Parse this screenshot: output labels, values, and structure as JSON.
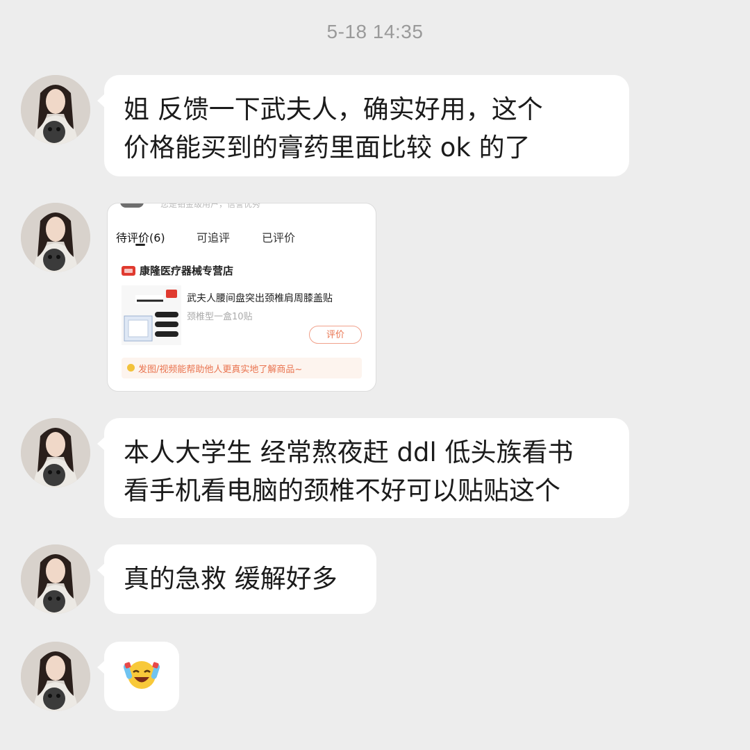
{
  "timestamp": "5-18 14:35",
  "messages": [
    {
      "lines": [
        "姐 反馈一下武夫人，确实好用，这个",
        "价格能买到的膏药里面比较 ok 的了"
      ]
    },
    {
      "lines": [
        "本人大学生 经常熬夜赶 ddl 低头族看书",
        "看手机看电脑的颈椎不好可以贴贴这个"
      ]
    },
    {
      "lines": [
        "真的急救 缓解好多"
      ]
    },
    {
      "emoji": "😆"
    }
  ],
  "screenshot": {
    "clipped_header": "您是铂金级用户，信誉优秀",
    "tabs": [
      "待评价(6)",
      "可追评",
      "已评价"
    ],
    "shop_name": "康隆医疗器械专营店",
    "product_title": "武夫人腰间盘突出颈椎肩周膝盖贴",
    "product_spec": "颈椎型一盒10贴",
    "review_button": "评价",
    "tip": "发图/视频能帮助他人更真实地了解商品~"
  },
  "colors": {
    "background": "#ededed",
    "bubble": "#ffffff",
    "accent": "#e9734f",
    "shop_logo": "#e03a2f"
  }
}
